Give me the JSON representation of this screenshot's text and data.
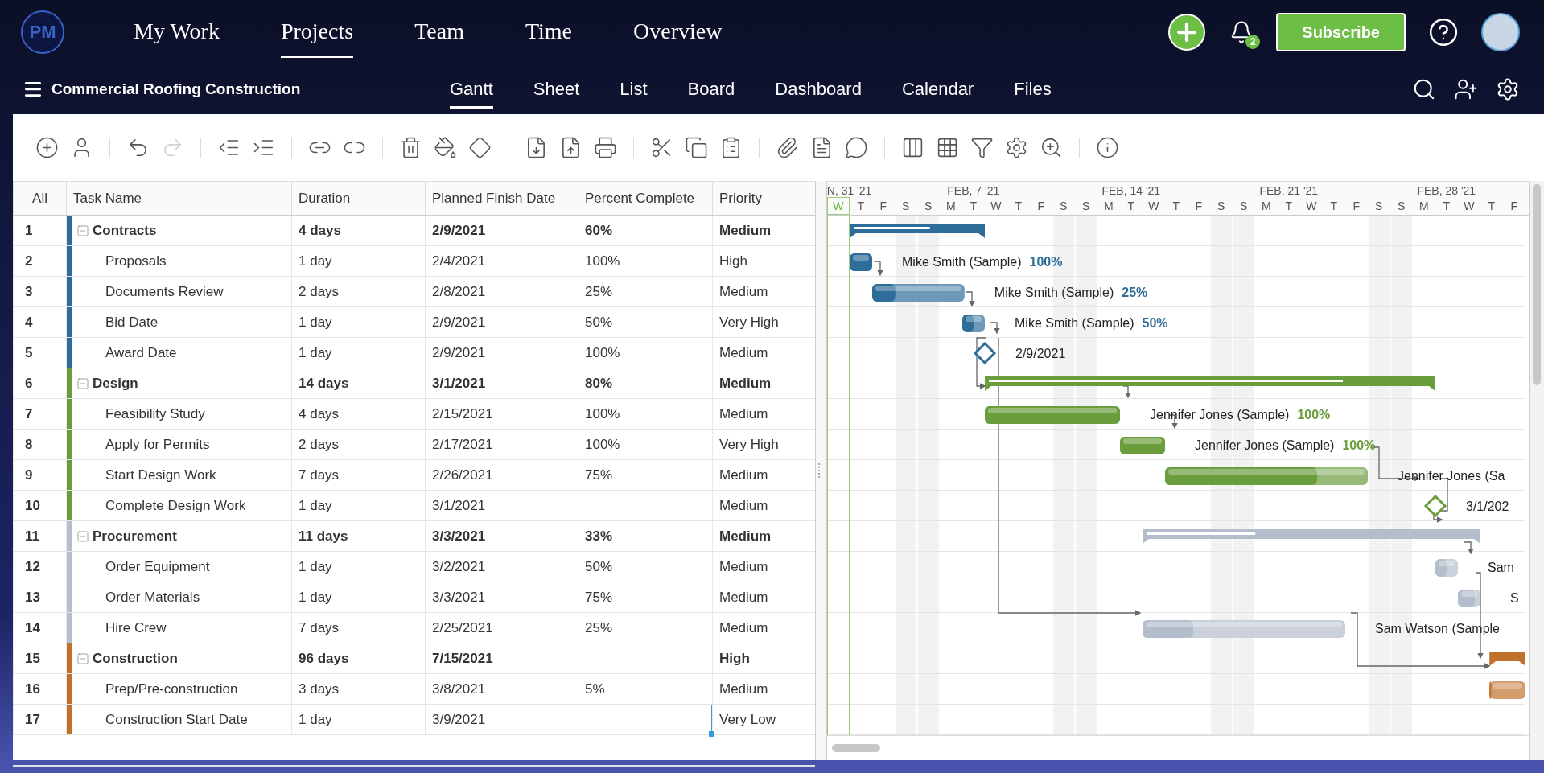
{
  "top_nav": {
    "logo": "PM",
    "items": [
      {
        "label": "My Work",
        "selected": false
      },
      {
        "label": "Projects",
        "selected": true
      },
      {
        "label": "Team",
        "selected": false
      },
      {
        "label": "Time",
        "selected": false
      },
      {
        "label": "Overview",
        "selected": false
      }
    ],
    "notification_count": "2",
    "subscribe": "Subscribe"
  },
  "project_bar": {
    "title": "Commercial Roofing Construction",
    "views": [
      {
        "label": "Gantt",
        "selected": true
      },
      {
        "label": "Sheet",
        "selected": false
      },
      {
        "label": "List",
        "selected": false
      },
      {
        "label": "Board",
        "selected": false
      },
      {
        "label": "Dashboard",
        "selected": false
      },
      {
        "label": "Calendar",
        "selected": false
      },
      {
        "label": "Files",
        "selected": false
      }
    ]
  },
  "toolbar": [
    [
      {
        "kind": "add",
        "disabled": false
      },
      {
        "kind": "assign",
        "disabled": false
      }
    ],
    [
      {
        "kind": "undo",
        "disabled": false
      },
      {
        "kind": "redo",
        "disabled": true
      }
    ],
    [
      {
        "kind": "outdent",
        "disabled": false
      },
      {
        "kind": "indent",
        "disabled": false
      }
    ],
    [
      {
        "kind": "link",
        "disabled": false
      },
      {
        "kind": "unlink",
        "disabled": false
      }
    ],
    [
      {
        "kind": "delete",
        "disabled": false
      },
      {
        "kind": "paint",
        "disabled": false
      },
      {
        "kind": "milestone",
        "disabled": false
      }
    ],
    [
      {
        "kind": "import",
        "disabled": false
      },
      {
        "kind": "export",
        "disabled": false
      },
      {
        "kind": "print",
        "disabled": false
      }
    ],
    [
      {
        "kind": "cut",
        "disabled": false
      },
      {
        "kind": "copy",
        "disabled": false
      },
      {
        "kind": "paste",
        "disabled": false
      }
    ],
    [
      {
        "kind": "attach",
        "disabled": false
      },
      {
        "kind": "notes",
        "disabled": false
      },
      {
        "kind": "comment",
        "disabled": false
      }
    ],
    [
      {
        "kind": "columns",
        "disabled": false
      },
      {
        "kind": "grid",
        "disabled": false
      },
      {
        "kind": "filter",
        "disabled": false
      },
      {
        "kind": "settings",
        "disabled": false
      },
      {
        "kind": "zoom",
        "disabled": false
      }
    ],
    [
      {
        "kind": "info",
        "disabled": false
      }
    ]
  ],
  "table": {
    "columns": [
      "All",
      "Task Name",
      "Duration",
      "Planned Finish Date",
      "Percent Complete",
      "Priority"
    ],
    "rows": [
      {
        "num": "1",
        "name": "Contracts",
        "duration": "4 days",
        "finish": "2/9/2021",
        "percent": "60%",
        "priority": "Medium",
        "color": "#2e6c99",
        "expanded": true,
        "selected": false,
        "children": [
          {
            "num": "2",
            "name": "Proposals",
            "duration": "1 day",
            "finish": "2/4/2021",
            "percent": "100%",
            "priority": "High",
            "selected": false,
            "bar_label": "Mike Smith (Sample)",
            "bar_percent": "100%"
          },
          {
            "num": "3",
            "name": "Documents Review",
            "duration": "2 days",
            "finish": "2/8/2021",
            "percent": "25%",
            "priority": "Medium",
            "selected": false,
            "bar_label": "Mike Smith (Sample)",
            "bar_percent": "25%"
          },
          {
            "num": "4",
            "name": "Bid Date",
            "duration": "1 day",
            "finish": "2/9/2021",
            "percent": "50%",
            "priority": "Very High",
            "selected": false,
            "bar_label": "Mike Smith (Sample)",
            "bar_percent": "50%"
          },
          {
            "num": "5",
            "name": "Award Date",
            "duration": "1 day",
            "finish": "2/9/2021",
            "percent": "100%",
            "priority": "Medium",
            "selected": false,
            "bar_label": "2/9/2021"
          }
        ]
      },
      {
        "num": "6",
        "name": "Design",
        "duration": "14 days",
        "finish": "3/1/2021",
        "percent": "80%",
        "priority": "Medium",
        "color": "#6a9d3c",
        "expanded": true,
        "selected": false,
        "children": [
          {
            "num": "7",
            "name": "Feasibility Study",
            "duration": "4 days",
            "finish": "2/15/2021",
            "percent": "100%",
            "priority": "Medium",
            "selected": false,
            "bar_label": "Jennifer Jones (Sample)",
            "bar_percent": "100%"
          },
          {
            "num": "8",
            "name": "Apply for Permits",
            "duration": "2 days",
            "finish": "2/17/2021",
            "percent": "100%",
            "priority": "Very High",
            "selected": false,
            "bar_label": "Jennifer Jones (Sample)",
            "bar_percent": "100%"
          },
          {
            "num": "9",
            "name": "Start Design Work",
            "duration": "7 days",
            "finish": "2/26/2021",
            "percent": "75%",
            "priority": "Medium",
            "selected": false,
            "bar_label": "Jennifer Jones (Sa"
          },
          {
            "num": "10",
            "name": "Complete Design Work",
            "duration": "1 day",
            "finish": "3/1/2021",
            "priority": "Medium",
            "selected": false,
            "bar_label": "3/1/202"
          }
        ]
      },
      {
        "num": "11",
        "name": "Procurement",
        "duration": "11 days",
        "finish": "3/3/2021",
        "percent": "33%",
        "priority": "Medium",
        "color": "#b4bdcc",
        "expanded": true,
        "selected": false,
        "children": [
          {
            "num": "12",
            "name": "Order Equipment",
            "duration": "1 day",
            "finish": "3/2/2021",
            "percent": "50%",
            "priority": "Medium",
            "selected": false,
            "bar_label": "Sam"
          },
          {
            "num": "13",
            "name": "Order Materials",
            "duration": "1 day",
            "finish": "3/3/2021",
            "percent": "75%",
            "priority": "Medium",
            "selected": false,
            "bar_label": "S"
          },
          {
            "num": "14",
            "name": "Hire Crew",
            "duration": "7 days",
            "finish": "2/25/2021",
            "percent": "25%",
            "priority": "Medium",
            "selected": false,
            "bar_label": "Sam Watson (Sample"
          }
        ]
      },
      {
        "num": "15",
        "name": "Construction",
        "duration": "96 days",
        "finish": "7/15/2021",
        "priority": "High",
        "color": "#c0722c",
        "expanded": true,
        "selected": false,
        "children": [
          {
            "num": "16",
            "name": "Prep/Pre-construction",
            "duration": "3 days",
            "finish": "3/8/2021",
            "percent": "5%",
            "priority": "Medium",
            "selected": false
          },
          {
            "num": "17",
            "name": "Construction Start Date",
            "duration": "1 day",
            "finish": "3/9/2021",
            "priority": "Very Low",
            "selected": true
          }
        ]
      }
    ]
  },
  "gantt": {
    "weeks": [
      "N, 31 '21",
      "FEB, 7 '21",
      "FEB, 14 '21",
      "FEB, 21 '21",
      "FEB, 28 '21"
    ],
    "days": [
      {
        "label": "W",
        "selected": true,
        "weekend": false
      },
      {
        "label": "T",
        "selected": false,
        "weekend": false
      },
      {
        "label": "F",
        "selected": false,
        "weekend": false
      },
      {
        "label": "S",
        "selected": false,
        "weekend": true
      },
      {
        "label": "S",
        "selected": false,
        "weekend": true
      },
      {
        "label": "M",
        "selected": false,
        "weekend": false
      },
      {
        "label": "T",
        "selected": false,
        "weekend": false
      },
      {
        "label": "W",
        "selected": false,
        "weekend": false
      },
      {
        "label": "T",
        "selected": false,
        "weekend": false
      },
      {
        "label": "F",
        "selected": false,
        "weekend": false
      },
      {
        "label": "S",
        "selected": false,
        "weekend": true
      },
      {
        "label": "S",
        "selected": false,
        "weekend": true
      },
      {
        "label": "M",
        "selected": false,
        "weekend": false
      },
      {
        "label": "T",
        "selected": false,
        "weekend": false
      },
      {
        "label": "W",
        "selected": false,
        "weekend": false
      },
      {
        "label": "T",
        "selected": false,
        "weekend": false
      },
      {
        "label": "F",
        "selected": false,
        "weekend": false
      },
      {
        "label": "S",
        "selected": false,
        "weekend": true
      },
      {
        "label": "S",
        "selected": false,
        "weekend": true
      },
      {
        "label": "M",
        "selected": false,
        "weekend": false
      },
      {
        "label": "T",
        "selected": false,
        "weekend": false
      },
      {
        "label": "W",
        "selected": false,
        "weekend": false
      },
      {
        "label": "T",
        "selected": false,
        "weekend": false
      },
      {
        "label": "F",
        "selected": false,
        "weekend": false
      },
      {
        "label": "S",
        "selected": false,
        "weekend": true
      },
      {
        "label": "S",
        "selected": false,
        "weekend": true
      },
      {
        "label": "M",
        "selected": false,
        "weekend": false
      },
      {
        "label": "T",
        "selected": false,
        "weekend": false
      },
      {
        "label": "W",
        "selected": false,
        "weekend": false
      },
      {
        "label": "T",
        "selected": false,
        "weekend": false
      },
      {
        "label": "F",
        "selected": false,
        "weekend": false
      }
    ]
  }
}
